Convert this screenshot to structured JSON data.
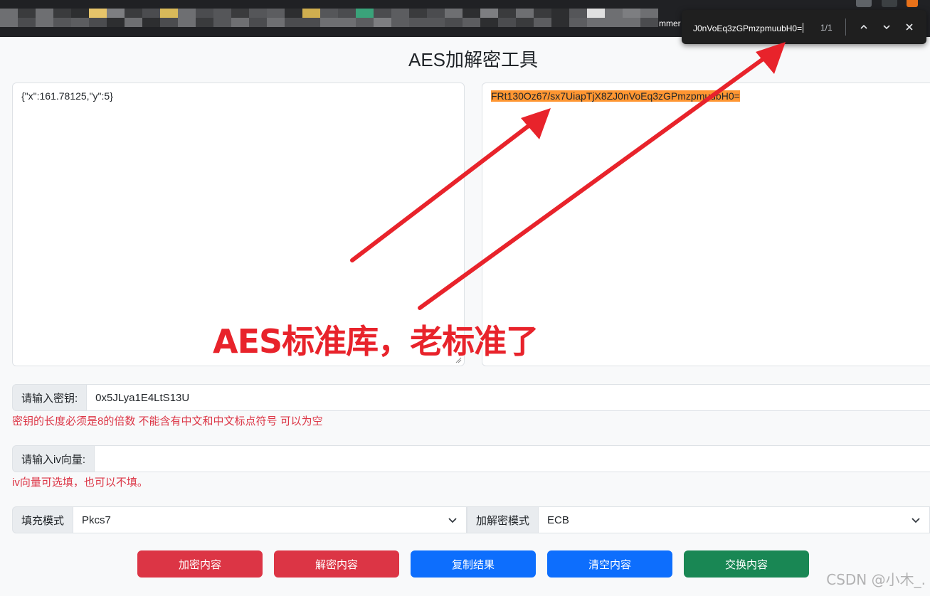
{
  "browser": {
    "tab_fragment": "mmer",
    "find_bar": {
      "query": "J0nVoEq3zGPmzpmuubH0=",
      "count": "1/1",
      "prev_icon": "chevron-up-icon",
      "next_icon": "chevron-down-icon",
      "close_icon": "close-icon"
    }
  },
  "page": {
    "title": "AES加解密工具",
    "input_text": "{\"x\":161.78125,\"y\":5}",
    "output_text": "FRt130Oz67/sx7UiapTjX8ZJ0nVoEq3zGPmzpmuubH0="
  },
  "key_field": {
    "label": "请输入密钥:",
    "value": "0x5JLya1E4LtS13U",
    "hint": "密钥的长度必须是8的倍数 不能含有中文和中文标点符号 可以为空"
  },
  "iv_field": {
    "label": "请输入iv向量:",
    "value": "",
    "hint": "iv向量可选填，也可以不填。"
  },
  "padding": {
    "label": "填充模式",
    "selected": "Pkcs7"
  },
  "mode": {
    "label": "加解密模式",
    "selected": "ECB"
  },
  "buttons": {
    "encrypt": "加密内容",
    "decrypt": "解密内容",
    "copy": "复制结果",
    "clear": "清空内容",
    "swap": "交换内容"
  },
  "annotation": {
    "text": "AES标准库，老标准了",
    "color": "#e8232b"
  },
  "watermark": "CSDN @小木_.",
  "colors": {
    "danger": "#dc3545",
    "primary": "#0d6efd",
    "success": "#198754",
    "highlight": "#ff9632"
  }
}
